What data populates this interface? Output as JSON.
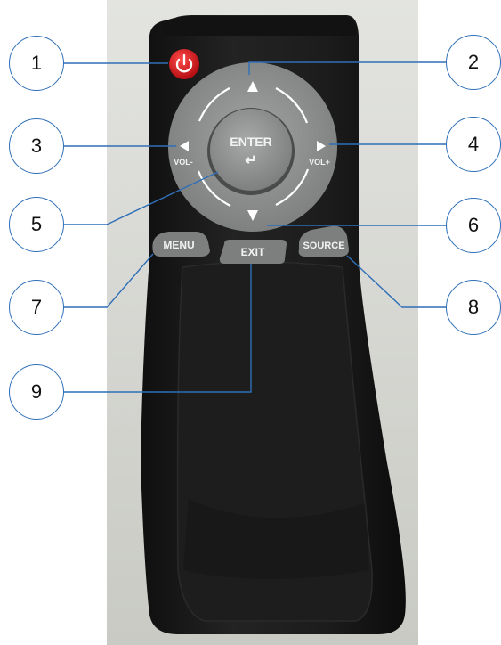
{
  "remote": {
    "enter_label": "ENTER",
    "enter_glyph": "↵",
    "vol_minus_label": "VOL-",
    "vol_plus_label": "VOL+",
    "menu_label": "MENU",
    "exit_label": "EXIT",
    "source_label": "SOURCE"
  },
  "callouts": [
    "1",
    "2",
    "3",
    "4",
    "5",
    "6",
    "7",
    "8",
    "9"
  ],
  "colors": {
    "callout_stroke": "#2f6fb7",
    "remote_body": "#1b1b1b",
    "power_button": "#d8161a",
    "dpad_ring": "#8a8c8c",
    "button_grey": "#7d7f7f"
  }
}
